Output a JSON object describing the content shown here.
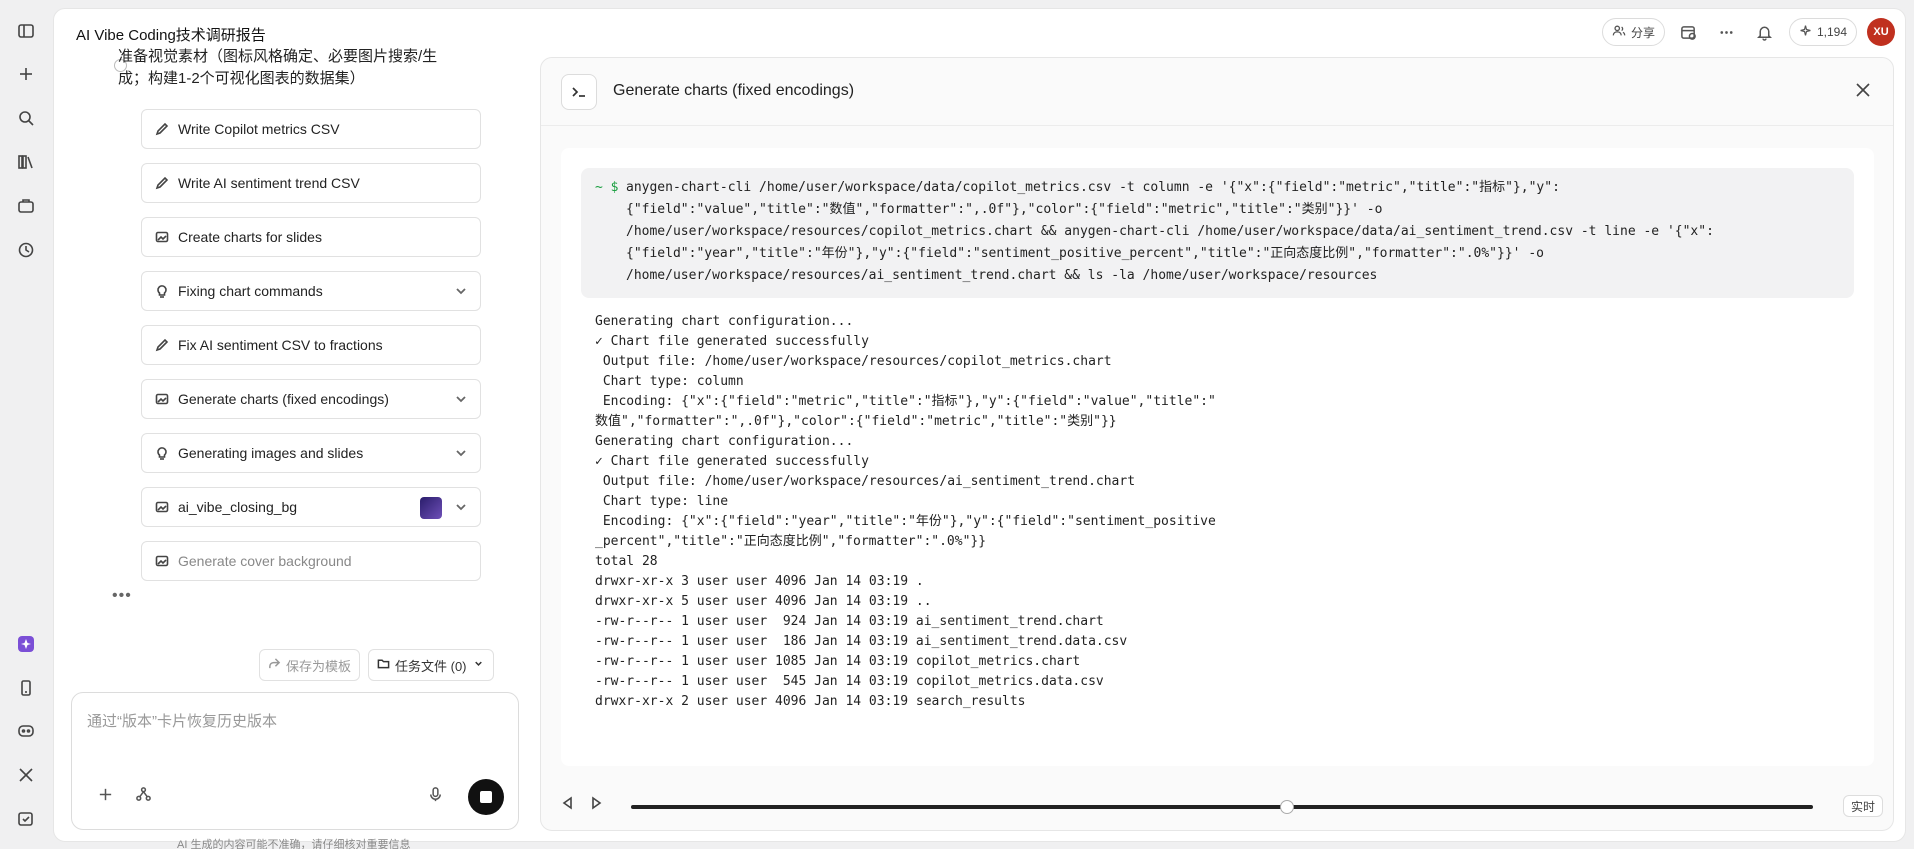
{
  "app": {
    "title": "AI Vibe Coding技术调研报告",
    "share_label": "分享",
    "credits": "1,194",
    "avatar_initials": "XU"
  },
  "chat": {
    "task_heading": "准备视觉素材（图标风格确定、必要图片搜索/生成；构建1-2个可视化图表的数据集）",
    "steps": [
      {
        "label": "Write Copilot metrics CSV",
        "icon": "edit-icon",
        "expandable": false
      },
      {
        "label": "Write AI sentiment trend CSV",
        "icon": "edit-icon",
        "expandable": false
      },
      {
        "label": "Create charts for slides",
        "icon": "image-icon",
        "expandable": false
      },
      {
        "label": "Fixing chart commands",
        "icon": "lightbulb-icon",
        "expandable": true
      },
      {
        "label": "Fix AI sentiment CSV to fractions",
        "icon": "edit-icon",
        "expandable": false
      },
      {
        "label": "Generate charts (fixed encodings)",
        "icon": "image-icon",
        "expandable": true
      },
      {
        "label": "Generating images and slides",
        "icon": "lightbulb-icon",
        "expandable": true
      },
      {
        "label": "ai_vibe_closing_bg",
        "icon": "image-icon",
        "expandable": true
      },
      {
        "label": "Generate cover background",
        "icon": "image-icon",
        "expandable": false
      }
    ],
    "save_template_label": "保存为模板",
    "task_files_label": "任务文件 (0)",
    "composer_placeholder": "通过“版本”卡片恢复历史版本",
    "disclaimer": "AI 生成的内容可能不准确，请仔细核对重要信息"
  },
  "panel": {
    "title": "Generate charts (fixed encodings)",
    "prompt": "~ $",
    "command": "anygen-chart-cli /home/user/workspace/data/copilot_metrics.csv -t column -e '{\"x\":{\"field\":\"metric\",\"title\":\"指标\"},\"y\":\n{\"field\":\"value\",\"title\":\"数值\",\"formatter\":\",.0f\"},\"color\":{\"field\":\"metric\",\"title\":\"类别\"}}' -o\n/home/user/workspace/resources/copilot_metrics.chart && anygen-chart-cli /home/user/workspace/data/ai_sentiment_trend.csv -t line -e '{\"x\":\n{\"field\":\"year\",\"title\":\"年份\"},\"y\":{\"field\":\"sentiment_positive_percent\",\"title\":\"正向态度比例\",\"formatter\":\".0%\"}}' -o\n/home/user/workspace/resources/ai_sentiment_trend.chart && ls -la /home/user/workspace/resources",
    "output_lines": [
      "Generating chart configuration...",
      "✓ Chart file generated successfully",
      " Output file: /home/user/workspace/resources/copilot_metrics.chart",
      " Chart type: column",
      " Encoding: {\"x\":{\"field\":\"metric\",\"title\":\"指标\"},\"y\":{\"field\":\"value\",\"title\":\"",
      "数值\",\"formatter\":\",.0f\"},\"color\":{\"field\":\"metric\",\"title\":\"类别\"}}",
      "Generating chart configuration...",
      "✓ Chart file generated successfully",
      " Output file: /home/user/workspace/resources/ai_sentiment_trend.chart",
      " Chart type: line",
      " Encoding: {\"x\":{\"field\":\"year\",\"title\":\"年份\"},\"y\":{\"field\":\"sentiment_positive",
      "_percent\",\"title\":\"正向态度比例\",\"formatter\":\".0%\"}}",
      "total 28",
      "drwxr-xr-x 3 user user 4096 Jan 14 03:19 .",
      "drwxr-xr-x 5 user user 4096 Jan 14 03:19 ..",
      "-rw-r--r-- 1 user user  924 Jan 14 03:19 ai_sentiment_trend.chart",
      "-rw-r--r-- 1 user user  186 Jan 14 03:19 ai_sentiment_trend.data.csv",
      "-rw-r--r-- 1 user user 1085 Jan 14 03:19 copilot_metrics.chart",
      "-rw-r--r-- 1 user user  545 Jan 14 03:19 copilot_metrics.data.csv",
      "drwxr-xr-x 2 user user 4096 Jan 14 03:19 search_results"
    ],
    "playback_progress": 0.555,
    "live_label": "实时"
  },
  "colors": {
    "avatar": "#c0301f",
    "prompt": "#1a9e3f",
    "rail_active": "#7b4fd6"
  }
}
